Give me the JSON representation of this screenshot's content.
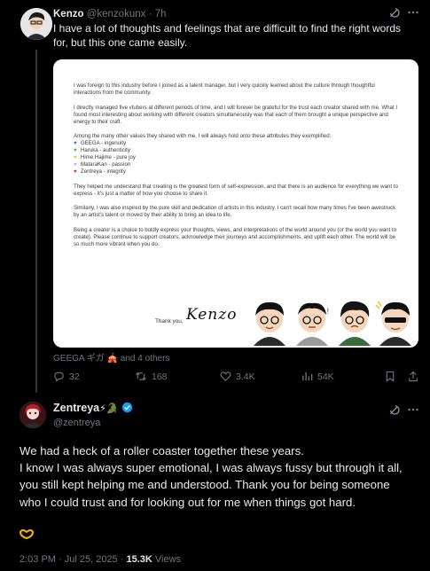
{
  "tweet1": {
    "author_name": "Kenzo",
    "author_handle": "@kenzokunx",
    "separator": "·",
    "time": "7h",
    "text": "I have a lot of thoughts and feelings that are difficult to find the right words for, but this one came easily.",
    "letter": {
      "paragraphs": [
        "I was foreign to this industry before I joined as a talent manager, but I very quickly learned about the culture through thoughtful interactions from the community.",
        "I directly managed five vtubers at different periods of time, and I will forever be grateful for the trust each creator shared with me. What I found most interesting about working with different creators simultaneously was that each of them brought a unique perspective and energy to their craft.",
        "Among the many other values they shared with me, I will always hold onto these attributes they exemplified:"
      ],
      "attributes": [
        {
          "text": "GEEGA - ingenuity",
          "color": "#1d6fd6"
        },
        {
          "text": "Haruka - authenticity",
          "color": "#3fb13f"
        },
        {
          "text": "Hime Hajime - pure joy",
          "color": "#f2c21b"
        },
        {
          "text": "MataraKan - passion",
          "color": "#f38ad1"
        },
        {
          "text": "Zentreya - integrity",
          "color": "#d62a2a"
        }
      ],
      "paragraphs2": [
        "They helped me understand that creating is the greatest form of self-expression, and that there is an audience for everything we want to express - it's just a matter of how you choose to share it.",
        "Similarly, I was also inspired by the pure skill and dedication of artists in this industry. I can't recall how many times I've been awestruck by an artist's talent or moved by their ability to bring an idea to life.",
        "Being a creator is a choice to boldly express your thoughts, views, and interpretations of the world around you (or the world you want to create). Please continue to support creators, acknowledge their journeys and accomplishments, and uplift each other. The world will be so much more vibrant when you do."
      ],
      "signoff": "Thank you,",
      "signature": "Kenzo"
    },
    "tagged_text": "GEEGA ギガ 🎪 and 4 others",
    "stats": {
      "replies": "32",
      "reposts": "168",
      "likes": "3.4K",
      "views": "54K"
    }
  },
  "tweet2": {
    "author_name": "Zentreya",
    "name_emojis": "⚡🐊",
    "author_handle": "@zentreya",
    "text": "We had a heck of a roller coaster together these years.\nI know I was always super emotional, I was always fussy but through it all, you still kept helping me and understood. Thank you for being someone who I could trust and for looking out for me when things got hard.",
    "emoji_end": "🫶",
    "time": "2:03 PM · Jul 25, 2025 ·",
    "views_count": "15.3K",
    "views_label": "Views"
  },
  "colors": {
    "background": "#000000",
    "text": "#e7e9ea",
    "muted": "#71767b",
    "divider": "#2f3336",
    "verified": "#1d9bf0"
  }
}
